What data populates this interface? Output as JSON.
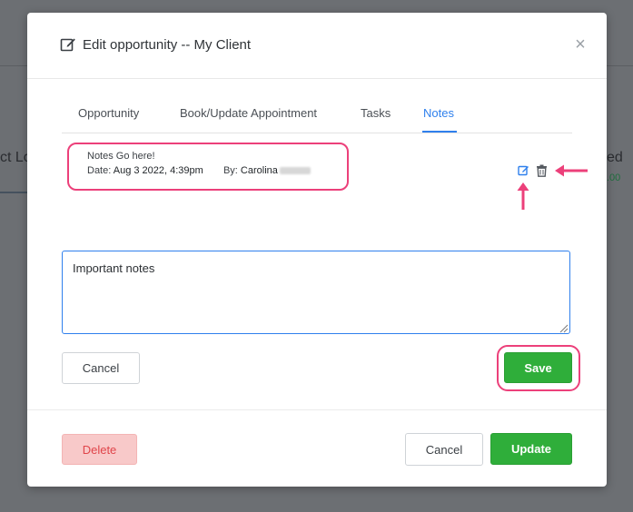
{
  "background": {
    "left_text": "ct Lo",
    "right_text": "ed",
    "right_sub": ".00"
  },
  "modal": {
    "title": "Edit opportunity -- My Client",
    "close_label": "×"
  },
  "tabs": [
    {
      "label": "Opportunity",
      "active": false
    },
    {
      "label": "Book/Update Appointment",
      "active": false
    },
    {
      "label": "Tasks",
      "active": false
    },
    {
      "label": "Notes",
      "active": true
    }
  ],
  "note": {
    "text": "Notes Go here!",
    "date_label": "Date:",
    "date_value": "Aug 3 2022, 4:39pm",
    "by_label": "By:",
    "by_value": "Carolina"
  },
  "editor": {
    "value": "Important notes",
    "cancel_label": "Cancel",
    "save_label": "Save"
  },
  "footer": {
    "delete_label": "Delete",
    "cancel_label": "Cancel",
    "update_label": "Update"
  },
  "colors": {
    "accent": "#2f80ed",
    "success": "#2fae3a",
    "danger": "#e0454a",
    "annotation": "#ec407a"
  }
}
